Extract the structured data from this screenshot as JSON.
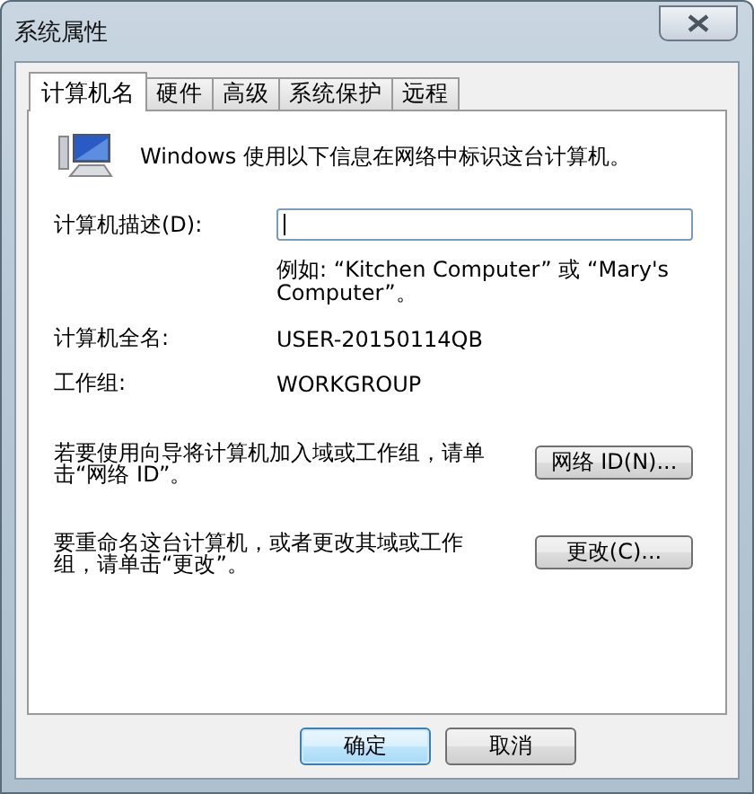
{
  "window": {
    "title": "系统属性"
  },
  "tabs": [
    {
      "label": "计算机名",
      "selected": true
    },
    {
      "label": "硬件",
      "selected": false
    },
    {
      "label": "高级",
      "selected": false
    },
    {
      "label": "系统保护",
      "selected": false
    },
    {
      "label": "远程",
      "selected": false
    }
  ],
  "intro": "Windows 使用以下信息在网络中标识这台计算机。",
  "description": {
    "label": "计算机描述(D):",
    "example": "例如: “Kitchen Computer” 或 “Mary's Computer”。"
  },
  "fields": [
    {
      "label": "计算机全名:",
      "value": "USER-20150114QB"
    },
    {
      "label": "工作组:",
      "value": "WORKGROUP"
    }
  ],
  "actions": [
    {
      "text": "若要使用向导将计算机加入域或工作组，请单击“网络 ID”。",
      "button": "网络 ID(N)..."
    },
    {
      "text": "要重命名这台计算机，或者更改其域或工作组，请单击“更改”。",
      "button": "更改(C)..."
    }
  ],
  "buttons": [
    {
      "label": "确定",
      "default": true
    },
    {
      "label": "取消",
      "default": false
    }
  ]
}
